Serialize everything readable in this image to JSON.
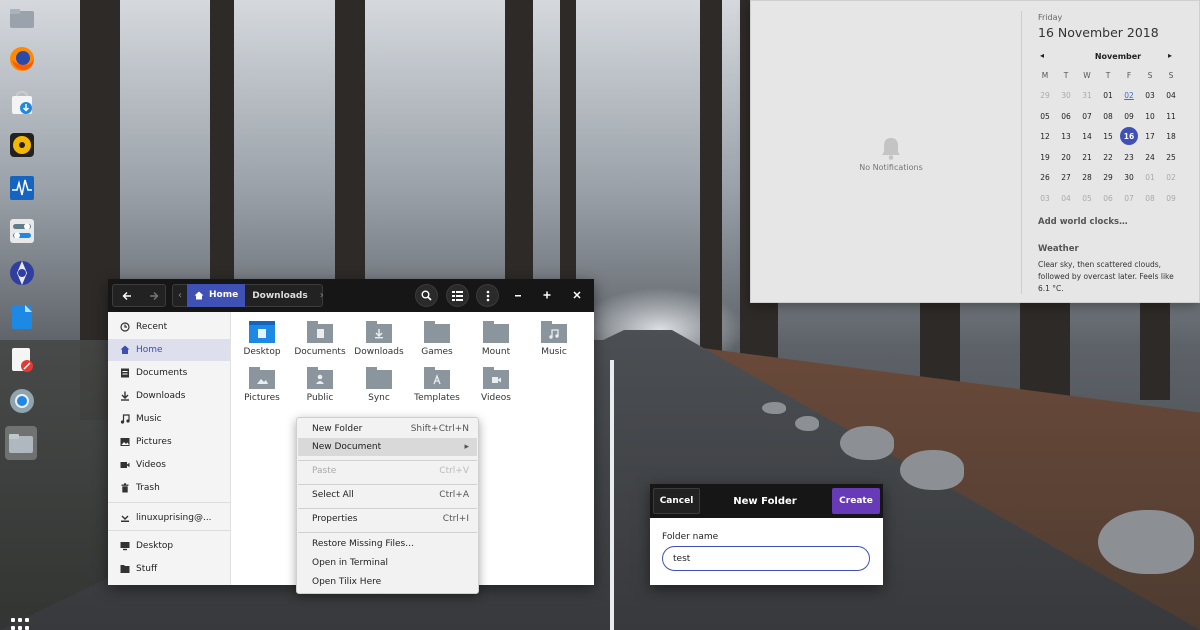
{
  "file_manager": {
    "breadcrumbs": [
      "Home",
      "Downloads"
    ],
    "sidebar": [
      {
        "label": "Recent",
        "icon": "clock-icon"
      },
      {
        "label": "Home",
        "icon": "home-icon",
        "selected": true
      },
      {
        "label": "Documents",
        "icon": "document-icon"
      },
      {
        "label": "Downloads",
        "icon": "download-icon"
      },
      {
        "label": "Music",
        "icon": "music-note-icon"
      },
      {
        "label": "Pictures",
        "icon": "picture-icon"
      },
      {
        "label": "Videos",
        "icon": "video-icon"
      },
      {
        "label": "Trash",
        "icon": "trash-icon"
      },
      {
        "label": "linuxuprising@...",
        "icon": "network-drive-icon"
      },
      {
        "label": "Desktop",
        "icon": "desktop-icon"
      },
      {
        "label": "Stuff",
        "icon": "folder-icon"
      }
    ],
    "files": [
      {
        "label": "Desktop",
        "icon": "desktop-folder-icon"
      },
      {
        "label": "Documents",
        "icon": "documents-folder-icon"
      },
      {
        "label": "Downloads",
        "icon": "downloads-folder-icon"
      },
      {
        "label": "Games",
        "icon": "folder-icon"
      },
      {
        "label": "Mount",
        "icon": "folder-icon"
      },
      {
        "label": "Music",
        "icon": "music-folder-icon"
      },
      {
        "label": "Pictures",
        "icon": "pictures-folder-icon"
      },
      {
        "label": "Public",
        "icon": "public-folder-icon"
      },
      {
        "label": "Sync",
        "icon": "folder-icon"
      },
      {
        "label": "Templates",
        "icon": "templates-folder-icon"
      },
      {
        "label": "Videos",
        "icon": "videos-folder-icon"
      }
    ]
  },
  "context_menu": [
    {
      "label": "New Folder",
      "shortcut": "Shift+Ctrl+N"
    },
    {
      "label": "New Document",
      "shortcut": "▸",
      "highlighted": true
    },
    {
      "label": "Paste",
      "shortcut": "Ctrl+V",
      "disabled": true
    },
    {
      "label": "Select All",
      "shortcut": "Ctrl+A"
    },
    {
      "label": "Properties",
      "shortcut": "Ctrl+I"
    },
    {
      "label": "Restore Missing Files…",
      "shortcut": ""
    },
    {
      "label": "Open in Terminal",
      "shortcut": ""
    },
    {
      "label": "Open Tilix Here",
      "shortcut": ""
    }
  ],
  "dialog": {
    "cancel": "Cancel",
    "title": "New Folder",
    "create": "Create",
    "field_label": "Folder name",
    "field_value": "test"
  },
  "panel": {
    "no_notifications": "No Notifications",
    "day": "Friday",
    "date": "16 November 2018",
    "month": "November",
    "weekdays": [
      "M",
      "T",
      "W",
      "T",
      "F",
      "S",
      "S"
    ],
    "weeks": [
      [
        "29",
        "30",
        "31",
        "01",
        "02",
        "03",
        "04"
      ],
      [
        "05",
        "06",
        "07",
        "08",
        "09",
        "10",
        "11"
      ],
      [
        "12",
        "13",
        "14",
        "15",
        "16",
        "17",
        "18"
      ],
      [
        "19",
        "20",
        "21",
        "22",
        "23",
        "24",
        "25"
      ],
      [
        "26",
        "27",
        "28",
        "29",
        "30",
        "01",
        "02"
      ],
      [
        "03",
        "04",
        "05",
        "06",
        "07",
        "08",
        "09"
      ]
    ],
    "today": "16",
    "event_day": "02",
    "world_clocks": "Add world clocks…",
    "weather_title": "Weather",
    "weather_text": "Clear sky, then scattered clouds, followed by overcast later. Feels like 6.1 °C."
  },
  "dock": [
    "files-app-icon",
    "firefox-icon",
    "software-store-icon",
    "music-player-icon",
    "system-monitor-icon",
    "settings-toggle-icon",
    "shutter-icon",
    "document-viewer-icon",
    "text-editor-icon",
    "chromium-icon",
    "files-app-active-icon"
  ],
  "colors": {
    "accent": "#3f51b5",
    "create_button": "#673ab7",
    "header": "#161616"
  }
}
